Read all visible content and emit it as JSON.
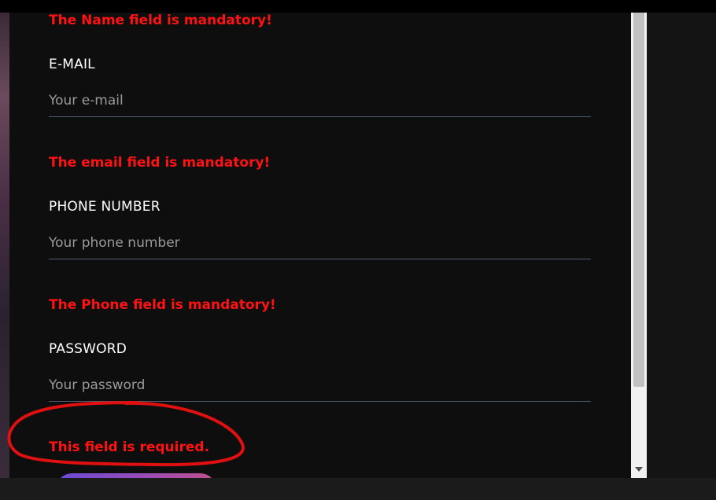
{
  "form": {
    "errors": {
      "name": "The Name field is mandatory!",
      "email": "The email field is mandatory!",
      "phone": "The Phone field is mandatory!",
      "password": "This field is required."
    },
    "fields": {
      "email": {
        "label": "E-MAIL",
        "placeholder": "Your e-mail",
        "value": ""
      },
      "phone": {
        "label": "PHONE NUMBER",
        "placeholder": "Your phone number",
        "value": ""
      },
      "password": {
        "label": "PASSWORD",
        "placeholder": "Your password",
        "value": ""
      }
    },
    "submit_button": {
      "label": ""
    }
  },
  "annotation": {
    "shape": "freehand-ellipse",
    "color": "#e01010"
  },
  "colors": {
    "error": "#ff1212",
    "panel_background": "#0e0e0e",
    "field_underline": "#4e5f74",
    "button_gradient_start": "#6a4ad8",
    "button_gradient_end": "#c0508c"
  },
  "scrollbar": {
    "position": 0.8
  }
}
